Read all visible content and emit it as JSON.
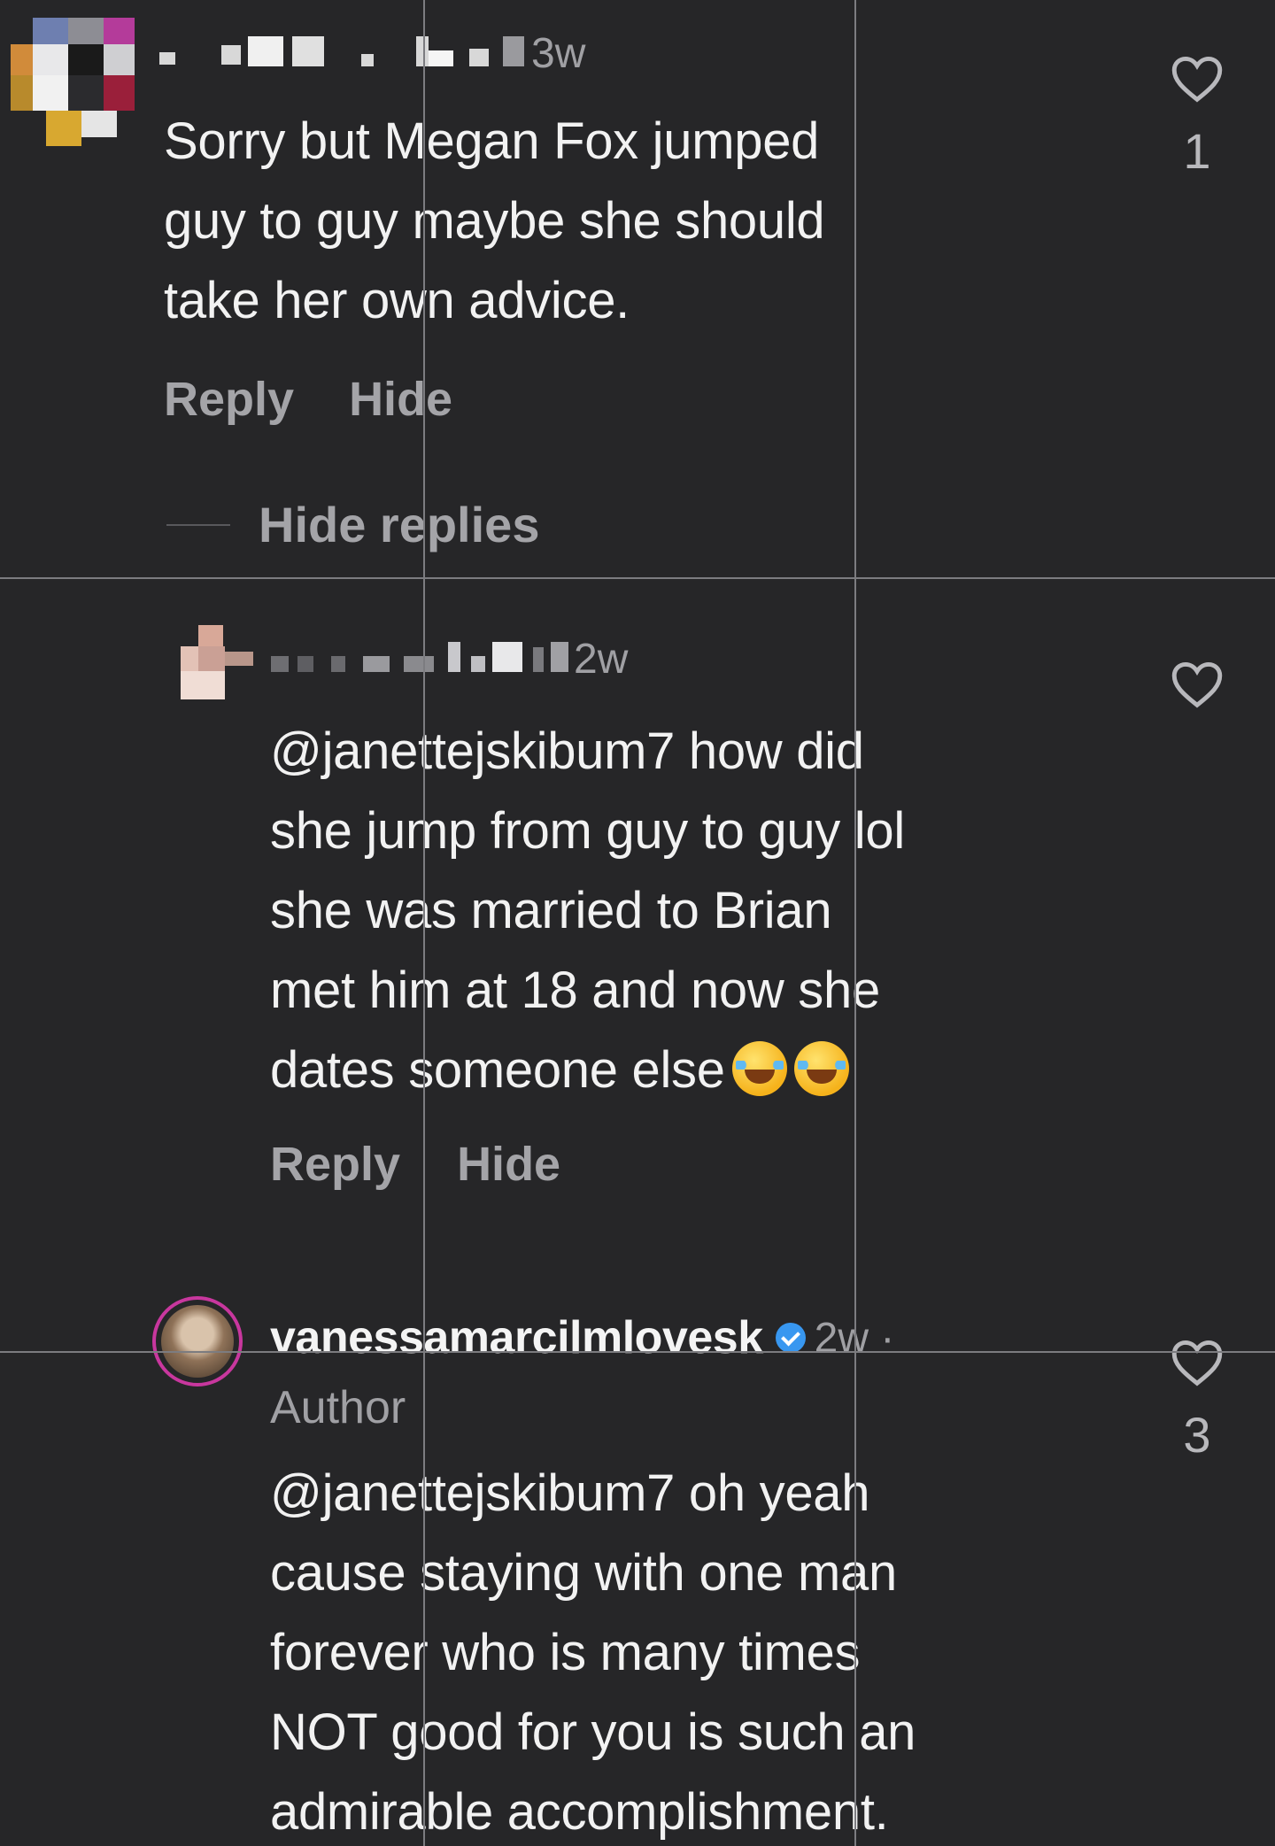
{
  "comments": [
    {
      "time": "3w",
      "lines": [
        "Sorry but Megan Fox jumped",
        "guy to guy maybe she should",
        "take her own advice."
      ],
      "actions": {
        "reply": "Reply",
        "hide": "Hide"
      },
      "like_count": "1",
      "hide_replies": "Hide replies"
    },
    {
      "time": "2w",
      "lines": [
        "@janettejskibum7 how did",
        "she jump from guy to guy lol",
        "she was married to Brian",
        "met him at 18 and now she",
        "dates someone else"
      ],
      "emoji": "😂😂",
      "actions": {
        "reply": "Reply",
        "hide": "Hide"
      }
    },
    {
      "username": "vanessamarcilmlovesk",
      "time": "2w ·",
      "author_tag": "Author",
      "lines": [
        "@janettejskibum7 oh yeah",
        "cause staying with one man",
        "forever who is many times",
        "NOT good for you is such an",
        "admirable accomplishment."
      ],
      "like_count": "3"
    }
  ],
  "icons": {
    "like": "heart-icon",
    "verified": "verified-badge-icon"
  },
  "colors": {
    "background": "#262628",
    "verified": "#3897f0",
    "muted": "#a4a4a8"
  }
}
